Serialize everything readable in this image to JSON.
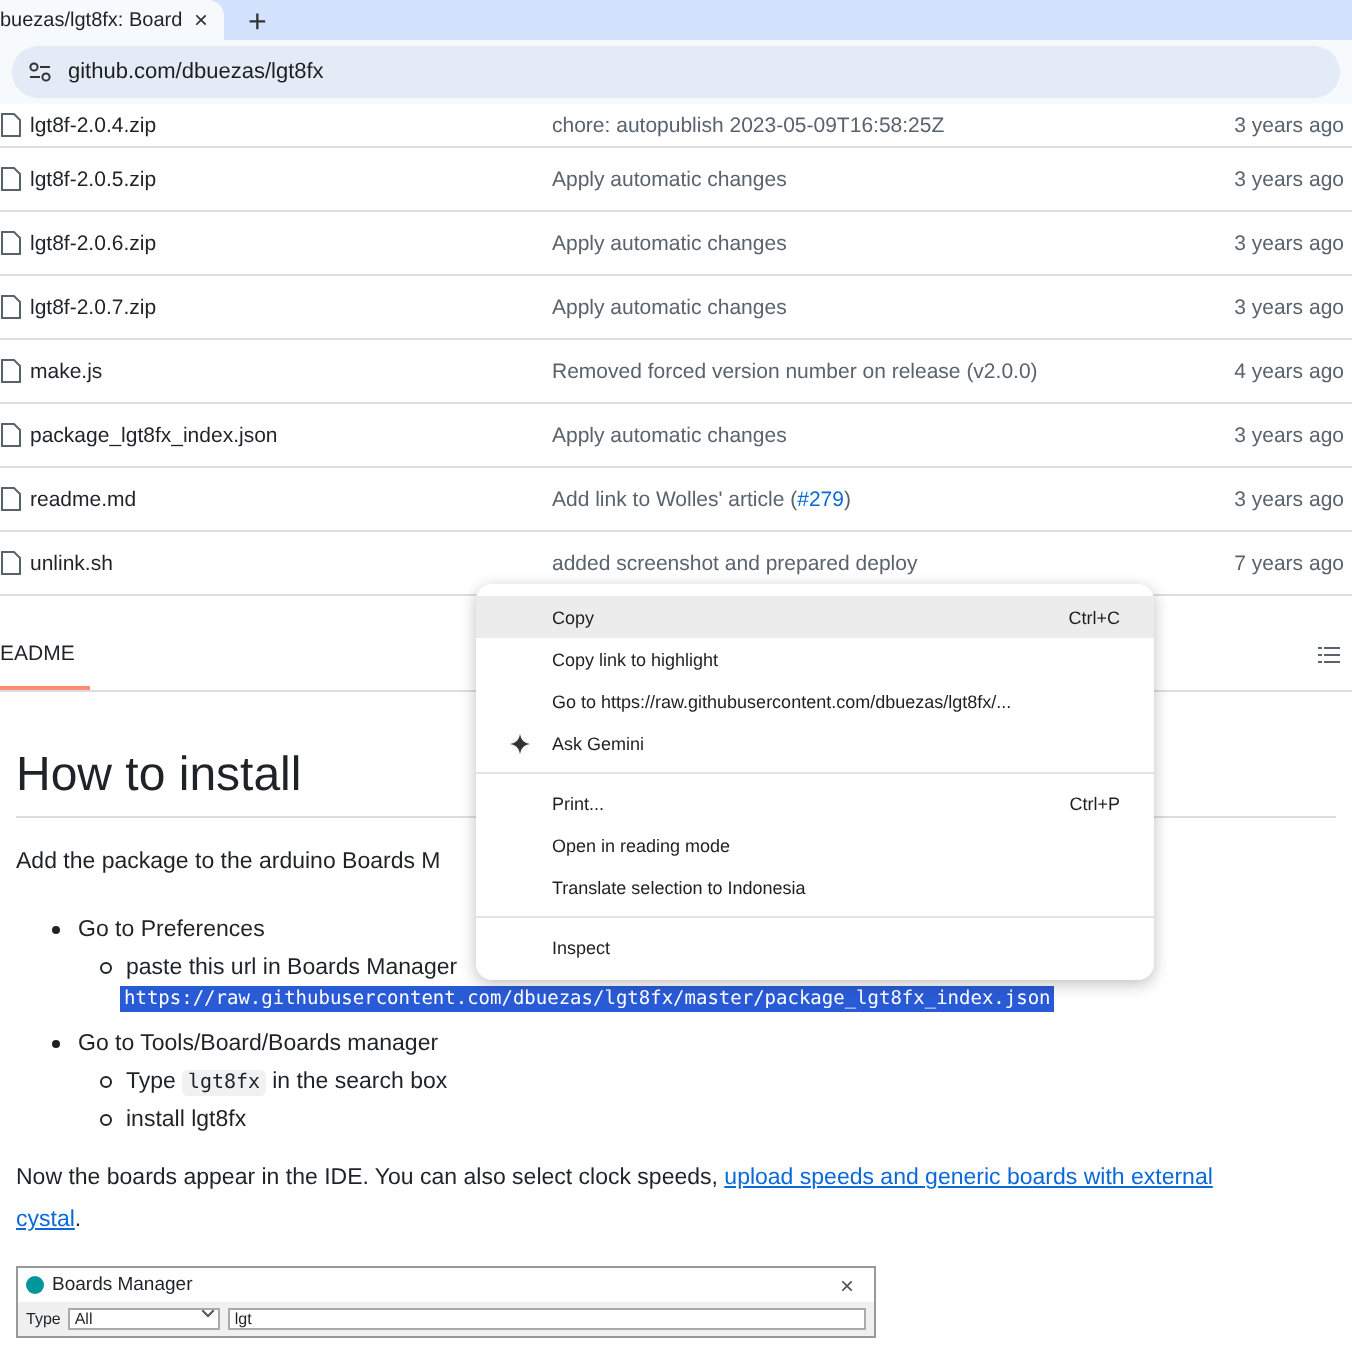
{
  "browser": {
    "tab": {
      "title": "buezas/lgt8fx: Board",
      "selected": true
    },
    "close": "×",
    "new_tab": "+",
    "address": "github.com/dbuezas/lgt8fx"
  },
  "files": [
    {
      "name": "lgt8f-2.0.4.zip",
      "message": "chore: autopublish 2023-05-09T16:58:25Z",
      "time": "3 years ago"
    },
    {
      "name": "lgt8f-2.0.5.zip",
      "message": "Apply automatic changes",
      "time": "3 years ago"
    },
    {
      "name": "lgt8f-2.0.6.zip",
      "message": "Apply automatic changes",
      "time": "3 years ago"
    },
    {
      "name": "lgt8f-2.0.7.zip",
      "message": "Apply automatic changes",
      "time": "3 years ago"
    },
    {
      "name": "make.js",
      "message": "Removed forced version number on release (v2.0.0)",
      "time": "4 years ago"
    },
    {
      "name": "package_lgt8fx_index.json",
      "message": "Apply automatic changes",
      "time": "3 years ago"
    },
    {
      "name": "readme.md",
      "message": "Add link to Wolles' article (",
      "issue": "#279",
      "message_end": ")",
      "time": "3 years ago"
    },
    {
      "name": "unlink.sh",
      "message": "added screenshot and prepared deploy",
      "time": "7 years ago"
    }
  ],
  "readme": {
    "tab": {
      "label": "EADME",
      "selected": true
    },
    "heading": "How to install",
    "intro": "Add the package to the arduino Boards M",
    "list": [
      {
        "text": "Go to Preferences",
        "children": [
          {
            "kind": "text",
            "text": "paste this url in Boards Manager",
            "url": "https://raw.githubusercontent.com/dbuezas/lgt8fx/master/package_lgt8fx_index.json"
          }
        ]
      },
      {
        "text": "Go to Tools/Board/Boards manager",
        "children": [
          {
            "kind": "code",
            "before": "Type",
            "code": "lgt8fx",
            "after": "in the search box"
          },
          {
            "kind": "text",
            "text": "install lgt8fx"
          }
        ]
      }
    ],
    "paragraph": {
      "text": "Now the boards appear in the IDE. You can also select clock speeds,",
      "link_lines": [
        "upload speeds and generic boards with external",
        "cystal"
      ],
      "end": "."
    },
    "boards_manager": {
      "title": "Boards Manager",
      "close": "×",
      "type_label": "Type",
      "type_value": "All",
      "search_value": "lgt"
    }
  },
  "context_menu": [
    {
      "kind": "item",
      "label": "Copy",
      "shortcut": "Ctrl+C",
      "selected": true
    },
    {
      "kind": "item",
      "label": "Copy link to highlight",
      "selected": false
    },
    {
      "kind": "item",
      "label": "Go to https://raw.githubusercontent.com/dbuezas/lgt8fx/...",
      "selected": false
    },
    {
      "kind": "ai-item",
      "label": "Ask Gemini",
      "selected": false
    },
    {
      "kind": "separator"
    },
    {
      "kind": "item",
      "label": "Print...",
      "shortcut": "Ctrl+P",
      "selected": false
    },
    {
      "kind": "item",
      "label": "Open in reading mode",
      "selected": false
    },
    {
      "kind": "item",
      "label": "Translate selection to Indonesia",
      "selected": false
    },
    {
      "kind": "separator"
    },
    {
      "kind": "item",
      "label": "Inspect",
      "selected": false
    }
  ]
}
